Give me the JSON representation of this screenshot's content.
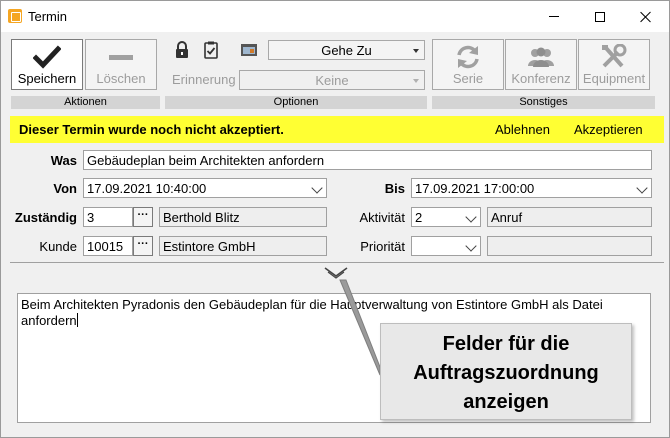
{
  "window": {
    "title": "Termin"
  },
  "ribbon": {
    "save_label": "Speichern",
    "delete_label": "Löschen",
    "actions_group": "Aktionen",
    "goto_value": "Gehe Zu",
    "reminder_label": "Erinnerung",
    "reminder_value": "Keine",
    "options_group": "Optionen",
    "series_label": "Serie",
    "conference_label": "Konferenz",
    "equipment_label": "Equipment",
    "misc_group": "Sonstiges"
  },
  "banner": {
    "message": "Dieser Termin wurde noch nicht akzeptiert.",
    "decline_label": "Ablehnen",
    "accept_label": "Akzeptieren",
    "color": "#ffff33"
  },
  "form": {
    "subject_label": "Was",
    "subject_value": "Gebäudeplan beim Architekten anfordern",
    "from_label": "Von",
    "from_value": "17.09.2021 10:40:00",
    "to_label": "Bis",
    "to_value": "17.09.2021 17:00:00",
    "responsible_label": "Zuständig",
    "responsible_id": "3",
    "responsible_name": "Berthold Blitz",
    "activity_label": "Aktivität",
    "activity_id": "2",
    "activity_name": "Anruf",
    "customer_label": "Kunde",
    "customer_id": "10015",
    "customer_name": "Estintore GmbH",
    "priority_label": "Priorität",
    "priority_id": "",
    "priority_name": "",
    "lookup_button": "···"
  },
  "memo": {
    "text": "Beim Architekten Pyradonis den Gebäudeplan für die Hauptverwaltung von Estintore GmbH als Datei anfordern"
  },
  "callout": {
    "line1": "Felder für die",
    "line2": "Auftragszuordnung",
    "line3": "anzeigen"
  }
}
